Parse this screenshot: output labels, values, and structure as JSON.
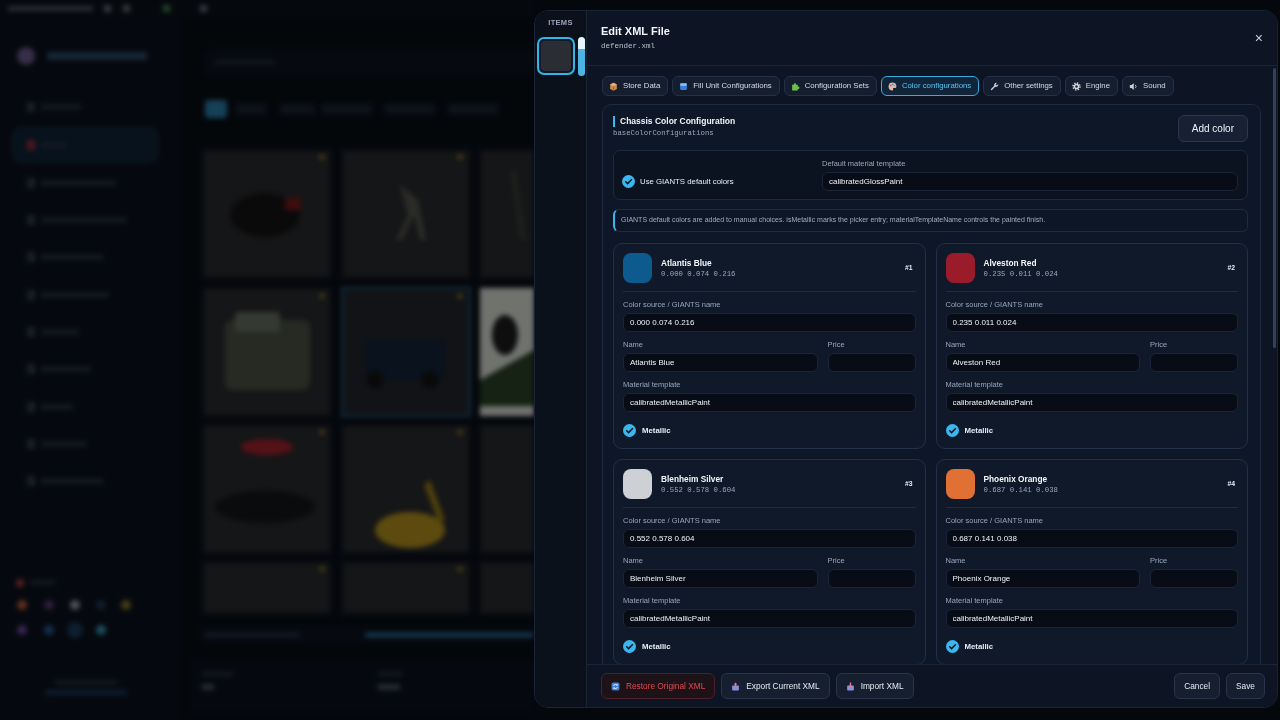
{
  "items_panel": {
    "title": "ITEMS",
    "items": [
      {
        "selected": true
      }
    ]
  },
  "dialog": {
    "title": "Edit XML File",
    "subtitle": "defender.xml",
    "close": "×"
  },
  "tabs": [
    {
      "label": "Store Data",
      "selected": false
    },
    {
      "label": "Fill Unit Configurations",
      "selected": false
    },
    {
      "label": "Configuration Sets",
      "selected": false
    },
    {
      "label": "Color configurations",
      "selected": true
    },
    {
      "label": "Other settings",
      "selected": false
    },
    {
      "label": "Engine",
      "selected": false
    },
    {
      "label": "Sound",
      "selected": false
    }
  ],
  "section": {
    "title": "Chassis Color Configuration",
    "key": "baseColorConfigurations",
    "add_button": "Add color"
  },
  "defaults": {
    "checkbox_label": "Use GIANTS default colors",
    "checked": true,
    "template_label": "Default material template",
    "template_value": "calibratedGlossPaint"
  },
  "note": "GIANTS default colors are added to manual choices. isMetallic marks the picker entry; materialTemplateName controls the painted finish.",
  "colors": [
    {
      "name": "Atlantis Blue",
      "rgb": "0.000 0.074 0.216",
      "number": "#1",
      "color": "#0d5a8e",
      "source_label": "Color source / GIANTS name",
      "source_value": "0.000 0.074 0.216",
      "name_label": "Name",
      "name_value": "Atlantis Blue",
      "price_label": "Price",
      "material_label": "Material template",
      "material_value": "calibratedMetallicPaint",
      "metallic_label": "Metallic",
      "metallic": true
    },
    {
      "name": "Alveston Red",
      "rgb": "0.235 0.011 0.024",
      "number": "#2",
      "color": "#9a1c2b",
      "source_label": "Color source / GIANTS name",
      "source_value": "0.235 0.011 0.024",
      "name_label": "Name",
      "name_value": "Alveston Red",
      "price_label": "Price",
      "material_label": "Material template",
      "material_value": "calibratedMetallicPaint",
      "metallic_label": "Metallic",
      "metallic": true
    },
    {
      "name": "Blenheim Silver",
      "rgb": "0.552 0.578 0.604",
      "number": "#3",
      "color": "#cdd0d4",
      "source_label": "Color source / GIANTS name",
      "source_value": "0.552 0.578 0.604",
      "name_label": "Name",
      "name_value": "Blenheim Silver",
      "price_label": "Price",
      "material_label": "Material template",
      "material_value": "calibratedMetallicPaint",
      "metallic_label": "Metallic",
      "metallic": true
    },
    {
      "name": "Phoenix Orange",
      "rgb": "0.687 0.141 0.038",
      "number": "#4",
      "color": "#e07034",
      "source_label": "Color source / GIANTS name",
      "source_value": "0.687 0.141 0.038",
      "name_label": "Name",
      "name_value": "Phoenix Orange",
      "price_label": "Price",
      "material_label": "Material template",
      "material_value": "calibratedMetallicPaint",
      "metallic_label": "Metallic",
      "metallic": true
    }
  ],
  "footer": {
    "left_buttons": [
      {
        "label": "Restore Original XML",
        "kind": "danger"
      },
      {
        "label": "Export Current XML",
        "kind": "default"
      },
      {
        "label": "Import XML",
        "kind": "default"
      }
    ],
    "right_buttons": [
      {
        "label": "Cancel"
      },
      {
        "label": "Save"
      }
    ]
  }
}
